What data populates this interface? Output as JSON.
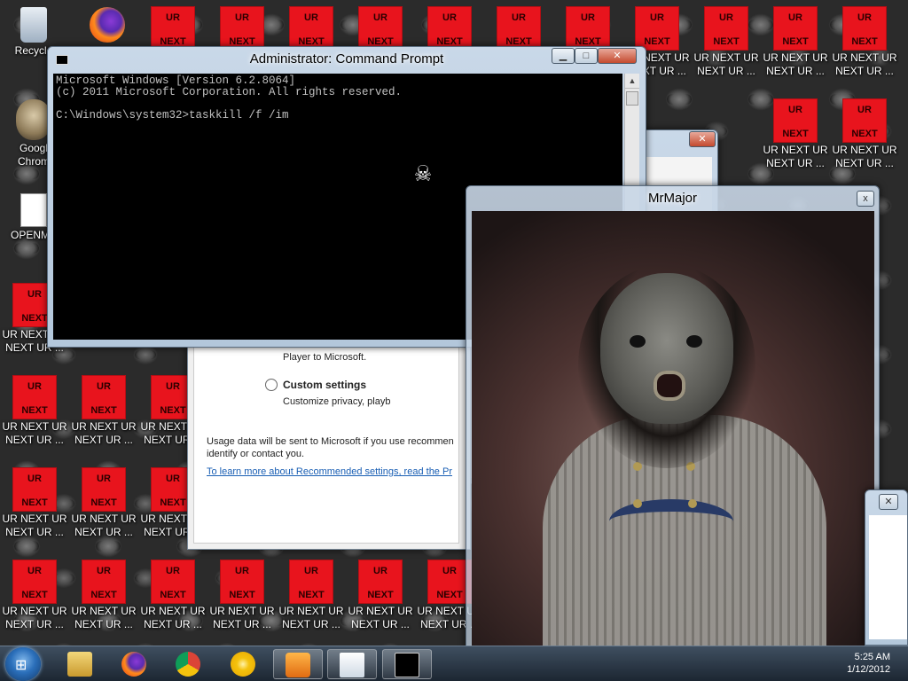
{
  "desktop": {
    "recycle_bin_label": "Recycle",
    "chrome_label_1": "Googl",
    "chrome_label_2": "Chrom",
    "openme_label": "OPENME",
    "ur_tile_top": "UR",
    "ur_tile_bottom": "NEXT",
    "ur_label_line1": "UR NEXT UR",
    "ur_label_line2": "NEXT UR ...",
    "ur_label_trunc1": "UR NEXT UR",
    "ur_label_trunc2": "NEXT UR ..."
  },
  "cmd": {
    "title": "Administrator: Command Prompt",
    "line1": "Microsoft Windows [Version 6.2.8064]",
    "line2": "(c) 2011 Microsoft Corporation. All rights reserved.",
    "line3": "",
    "line4": "C:\\Windows\\system32>taskkill /f /im",
    "min_label": "▁",
    "max_label": "□",
    "close_label": "✕",
    "cursor_glyph": "☠"
  },
  "wmp": {
    "line_player": "Player to Microsoft.",
    "custom_settings_label": "Custom settings",
    "custom_settings_desc": "Customize privacy, playb",
    "usage_line1": "Usage data will be sent to Microsoft if you use recommen",
    "usage_line2": "identify or contact you.",
    "link_text": "To learn more about Recommended settings, read the Pr"
  },
  "small1": {
    "close_label": "✕"
  },
  "mrmajor": {
    "title": "MrMajor",
    "close_label": "x"
  },
  "small2": {
    "close_label": "✕"
  },
  "taskbar": {
    "start_glyph": "⊞",
    "clock_time": "5:25 AM",
    "clock_date": "1/12/2012"
  }
}
